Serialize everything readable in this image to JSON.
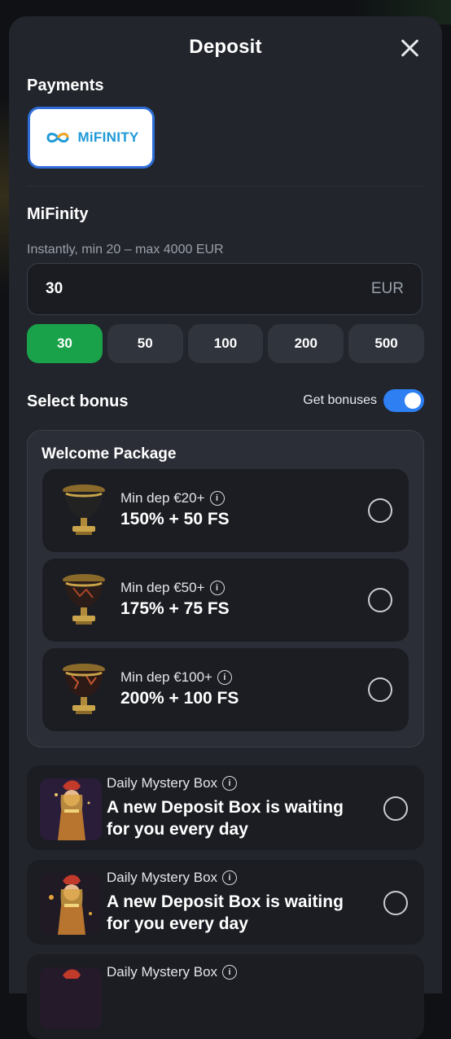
{
  "header": {
    "title": "Deposit"
  },
  "payments": {
    "heading": "Payments",
    "methods": [
      {
        "name": "MiFINITY",
        "selected": true
      }
    ]
  },
  "method": {
    "title": "MiFinity",
    "limits_hint": "Instantly, min 20 – max 4000 EUR",
    "amount_value": "30",
    "currency": "EUR",
    "quick_amounts": [
      "30",
      "50",
      "100",
      "200",
      "500"
    ],
    "selected_amount": "30"
  },
  "bonus": {
    "heading": "Select bonus",
    "toggle_label": "Get bonuses",
    "toggle_on": true,
    "welcome": {
      "title": "Welcome Package",
      "items": [
        {
          "min": "Min dep €20+",
          "value": "150% + 50 FS"
        },
        {
          "min": "Min dep €50+",
          "value": "175% + 75 FS"
        },
        {
          "min": "Min dep €100+",
          "value": "200% + 100 FS"
        }
      ]
    },
    "mystery": [
      {
        "label": "Daily Mystery Box",
        "desc": "A new Deposit Box is waiting for you every day"
      },
      {
        "label": "Daily Mystery Box",
        "desc": "A new Deposit Box is waiting for you every day"
      },
      {
        "label": "Daily Mystery Box"
      }
    ]
  },
  "colors": {
    "accent_green": "#1aa24a",
    "toggle_blue": "#2d7ff2",
    "card_border": "#2f6ed8",
    "logo_blue": "#1f9ad6"
  },
  "icons": [
    "close-icon",
    "info-icon",
    "trophy-urn-icon",
    "warrior-avatar"
  ]
}
